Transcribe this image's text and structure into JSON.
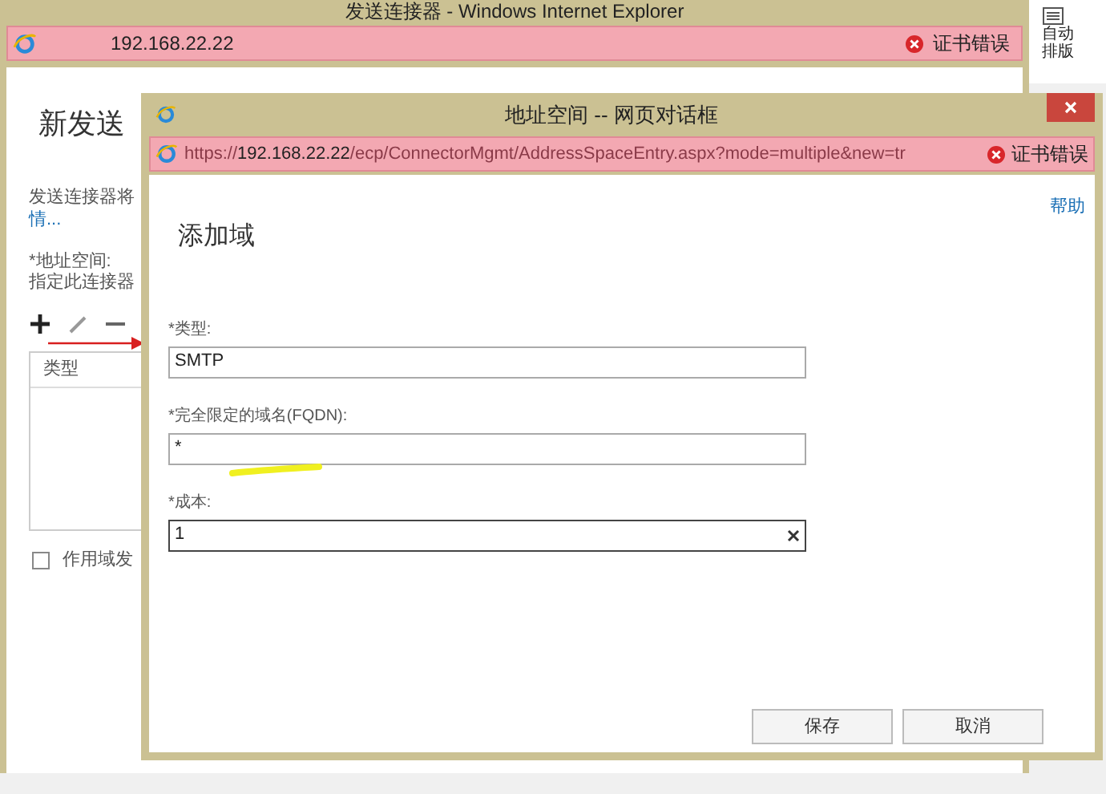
{
  "main_window": {
    "title": "发送连接器 - Windows Internet Explorer",
    "address_bar": {
      "host": "192.168.22.22",
      "cert_error": "证书错误"
    },
    "heading": "新发送",
    "description": "发送连接器将",
    "details_link": "情...",
    "address_space_label": "*地址空间:",
    "address_space_hint": "指定此连接器",
    "table": {
      "columns": [
        "类型"
      ]
    },
    "scope_checkbox": {
      "label": "作用域发",
      "checked": false
    }
  },
  "side_toolbar": {
    "label": "自动排版"
  },
  "dialog": {
    "title": "地址空间 -- 网页对话框",
    "address_bar": {
      "scheme": "https://",
      "host": "192.168.22.22",
      "path": "/ecp/ConnectorMgmt/AddressSpaceEntry.aspx?mode=multiple&new=tr",
      "cert_error": "证书错误"
    },
    "help": "帮助",
    "heading": "添加域",
    "fields": [
      {
        "label": "*类型:",
        "value": "SMTP",
        "focused": false
      },
      {
        "label": "*完全限定的域名(FQDN):",
        "value": "*",
        "focused": false
      },
      {
        "label": "*成本:",
        "value": "1",
        "focused": true
      }
    ],
    "buttons": [
      "保存",
      "取消"
    ]
  }
}
